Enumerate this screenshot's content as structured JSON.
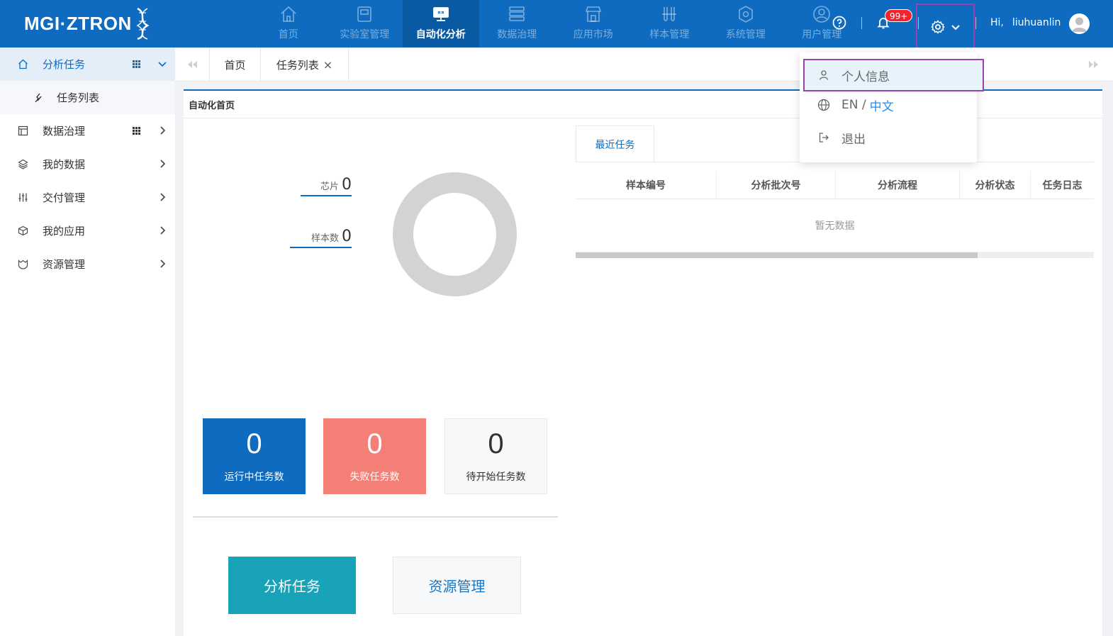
{
  "brand": {
    "logo_text": "MGI·ZTRON"
  },
  "nav": [
    {
      "label": "首页",
      "icon": "home-icon"
    },
    {
      "label": "实验室管理",
      "icon": "lab-icon"
    },
    {
      "label": "自动化分析",
      "icon": "monitor-icon",
      "active": true
    },
    {
      "label": "数据治理",
      "icon": "database-icon"
    },
    {
      "label": "应用市场",
      "icon": "store-icon"
    },
    {
      "label": "样本管理",
      "icon": "sample-icon"
    },
    {
      "label": "系统管理",
      "icon": "system-icon"
    },
    {
      "label": "用户管理",
      "icon": "user-icon"
    }
  ],
  "header": {
    "notification_badge": "99+",
    "greeting": "Hi,",
    "username": "liuhuanlin"
  },
  "sidebar": {
    "items": [
      {
        "label": "分析任务",
        "active": true,
        "expanded": true
      },
      {
        "label": "任务列表",
        "sub": true
      },
      {
        "label": "数据治理"
      },
      {
        "label": "我的数据"
      },
      {
        "label": "交付管理"
      },
      {
        "label": "我的应用"
      },
      {
        "label": "资源管理"
      }
    ]
  },
  "tabs": {
    "items": [
      {
        "label": "首页"
      },
      {
        "label": "任务列表",
        "closable_label": "×"
      }
    ]
  },
  "main": {
    "breadcrumb": "自动化首页",
    "stats": {
      "chip_label": "芯片",
      "chip_value": "0",
      "sample_label": "样本数",
      "sample_value": "0"
    },
    "cards": {
      "running": {
        "value": "0",
        "label": "运行中任务数"
      },
      "failed": {
        "value": "0",
        "label": "失败任务数"
      },
      "pending": {
        "value": "0",
        "label": "待开始任务数"
      }
    },
    "buttons": {
      "analysis": "分析任务",
      "resources": "资源管理"
    },
    "recent": {
      "tab_label": "最近任务",
      "columns": [
        "样本编号",
        "分析批次号",
        "分析流程",
        "分析状态",
        "任务日志"
      ],
      "empty_text": "暂无数据"
    }
  },
  "dropdown": {
    "profile": "个人信息",
    "lang_en": "EN /",
    "lang_zh": "中文",
    "logout": "退出"
  },
  "colors": {
    "header_bg": "#0e6bbf",
    "highlight_border": "#9b3fb5",
    "failed_card": "#f47f76",
    "primary_button": "#19a3b8"
  }
}
